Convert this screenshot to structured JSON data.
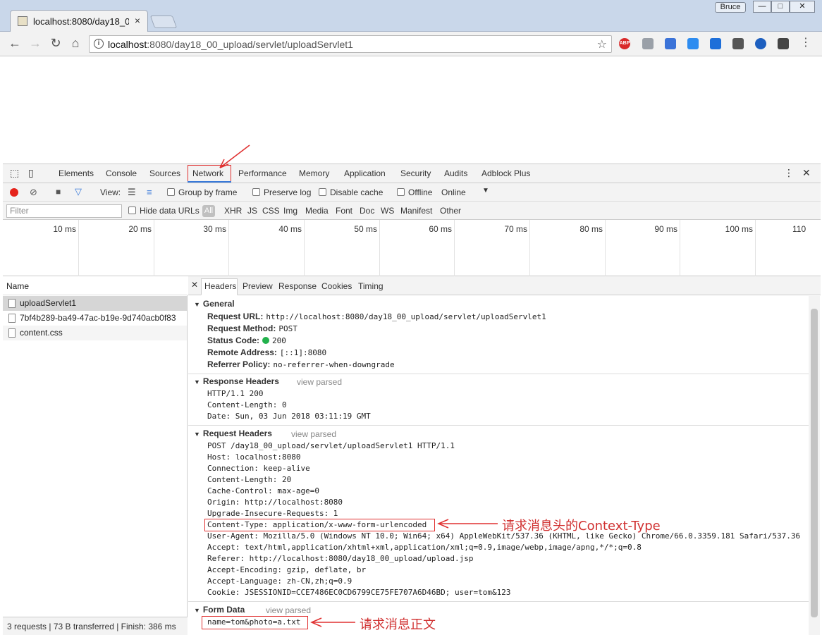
{
  "browser": {
    "tab_title": "localhost:8080/day18_0",
    "tab_close": "×",
    "user_label": "Bruce",
    "url_host": "localhost",
    "url_rest": ":8080/day18_00_upload/servlet/uploadServlet1",
    "abp_label": "ABP",
    "min_glyph": "—",
    "max_glyph": "□",
    "close_glyph": "✕"
  },
  "devtools": {
    "tabs": [
      "Elements",
      "Console",
      "Sources",
      "Network",
      "Performance",
      "Memory",
      "Application",
      "Security",
      "Audits",
      "Adblock Plus"
    ],
    "network_toolbar": {
      "view_label": "View:",
      "group_by_frame": "Group by frame",
      "preserve_log": "Preserve log",
      "disable_cache": "Disable cache",
      "offline": "Offline",
      "throttle": "Online"
    },
    "filter_bar": {
      "placeholder": "Filter",
      "hide_data_urls": "Hide data URLs",
      "types": [
        "All",
        "XHR",
        "JS",
        "CSS",
        "Img",
        "Media",
        "Font",
        "Doc",
        "WS",
        "Manifest",
        "Other"
      ]
    },
    "timeline_ticks": [
      "10 ms",
      "20 ms",
      "30 ms",
      "40 ms",
      "50 ms",
      "60 ms",
      "70 ms",
      "80 ms",
      "90 ms",
      "100 ms",
      "110"
    ],
    "name_header": "Name",
    "requests": [
      "uploadServlet1",
      "7bf4b289-ba49-47ac-b19e-9d740acb0f83",
      "content.css"
    ],
    "status_bar": "3 requests | 73 B transferred | Finish: 386 ms",
    "detail_tabs": [
      "Headers",
      "Preview",
      "Response",
      "Cookies",
      "Timing"
    ],
    "general": {
      "title": "General",
      "rows": [
        {
          "k": "Request URL:",
          "v": "http://localhost:8080/day18_00_upload/servlet/uploadServlet1"
        },
        {
          "k": "Request Method:",
          "v": "POST"
        },
        {
          "k": "Status Code:",
          "v": "200"
        },
        {
          "k": "Remote Address:",
          "v": "[::1]:8080"
        },
        {
          "k": "Referrer Policy:",
          "v": "no-referrer-when-downgrade"
        }
      ]
    },
    "response_headers": {
      "title": "Response Headers",
      "view_parsed": "view parsed",
      "lines": [
        "HTTP/1.1 200",
        "Content-Length: 0",
        "Date: Sun, 03 Jun 2018 03:11:19 GMT"
      ]
    },
    "request_headers": {
      "title": "Request Headers",
      "view_parsed": "view parsed",
      "lines": [
        "POST /day18_00_upload/servlet/uploadServlet1 HTTP/1.1",
        "Host: localhost:8080",
        "Connection: keep-alive",
        "Content-Length: 20",
        "Cache-Control: max-age=0",
        "Origin: http://localhost:8080",
        "Upgrade-Insecure-Requests: 1",
        "Content-Type: application/x-www-form-urlencoded",
        "User-Agent: Mozilla/5.0 (Windows NT 10.0; Win64; x64) AppleWebKit/537.36 (KHTML, like Gecko) Chrome/66.0.3359.181 Safari/537.36",
        "Accept: text/html,application/xhtml+xml,application/xml;q=0.9,image/webp,image/apng,*/*;q=0.8",
        "Referer: http://localhost:8080/day18_00_upload/upload.jsp",
        "Accept-Encoding: gzip, deflate, br",
        "Accept-Language: zh-CN,zh;q=0.9",
        "Cookie: JSESSIONID=CCE7486EC0CD6799CE75FE707A6D46BD; user=tom&123"
      ]
    },
    "form_data": {
      "title": "Form Data",
      "view_parsed": "view parsed",
      "value": "name=tom&photo=a.txt"
    }
  },
  "annotations": {
    "content_type_note": "请求消息头的Context-Type",
    "body_note": "请求消息正文"
  },
  "colors": {
    "record": "#e5231b",
    "status_ok": "#22b14c",
    "annotation": "#d03030"
  }
}
